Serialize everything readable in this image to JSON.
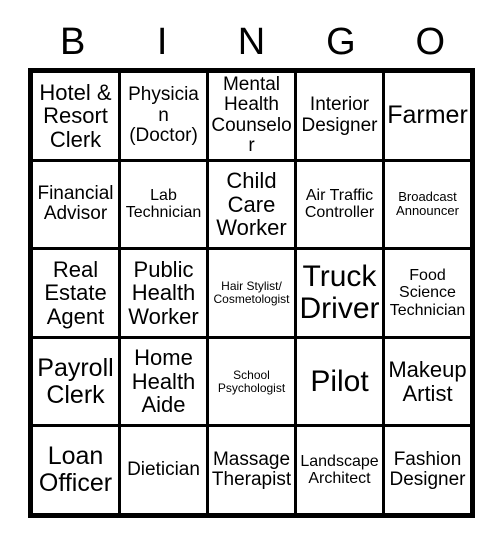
{
  "card": {
    "title": "BINGO",
    "header_letters": [
      "B",
      "I",
      "N",
      "G",
      "O"
    ],
    "rows": [
      [
        {
          "label": "Hotel & Resort Clerk",
          "size": "lg"
        },
        {
          "label": "Physician (Doctor)",
          "size": "md"
        },
        {
          "label": "Mental Health Counselor",
          "size": "md"
        },
        {
          "label": "Interior Designer",
          "size": "md"
        },
        {
          "label": "Farmer",
          "size": "xl"
        }
      ],
      [
        {
          "label": "Financial Advisor",
          "size": "md"
        },
        {
          "label": "Lab Technician",
          "size": "sm"
        },
        {
          "label": "Child Care Worker",
          "size": "lg"
        },
        {
          "label": "Air Traffic Controller",
          "size": "sm"
        },
        {
          "label": "Broadcast Announcer",
          "size": "xs"
        }
      ],
      [
        {
          "label": "Real Estate Agent",
          "size": "lg"
        },
        {
          "label": "Public Health Worker",
          "size": "lg"
        },
        {
          "label": "Hair Stylist/ Cosmetologist",
          "size": "xxs"
        },
        {
          "label": "Truck Driver",
          "size": "xxl"
        },
        {
          "label": "Food Science Technician",
          "size": "sm"
        }
      ],
      [
        {
          "label": "Payroll Clerk",
          "size": "xl"
        },
        {
          "label": "Home Health Aide",
          "size": "lg"
        },
        {
          "label": "School Psychologist",
          "size": "xxs"
        },
        {
          "label": "Pilot",
          "size": "xxl"
        },
        {
          "label": "Makeup Artist",
          "size": "lg"
        }
      ],
      [
        {
          "label": "Loan Officer",
          "size": "xl"
        },
        {
          "label": "Dietician",
          "size": "md"
        },
        {
          "label": "Massage Therapist",
          "size": "md"
        },
        {
          "label": "Landscape Architect",
          "size": "sm"
        },
        {
          "label": "Fashion Designer",
          "size": "md"
        }
      ]
    ]
  },
  "colors": {
    "background": "#ffffff",
    "text": "#000000",
    "border": "#000000"
  }
}
